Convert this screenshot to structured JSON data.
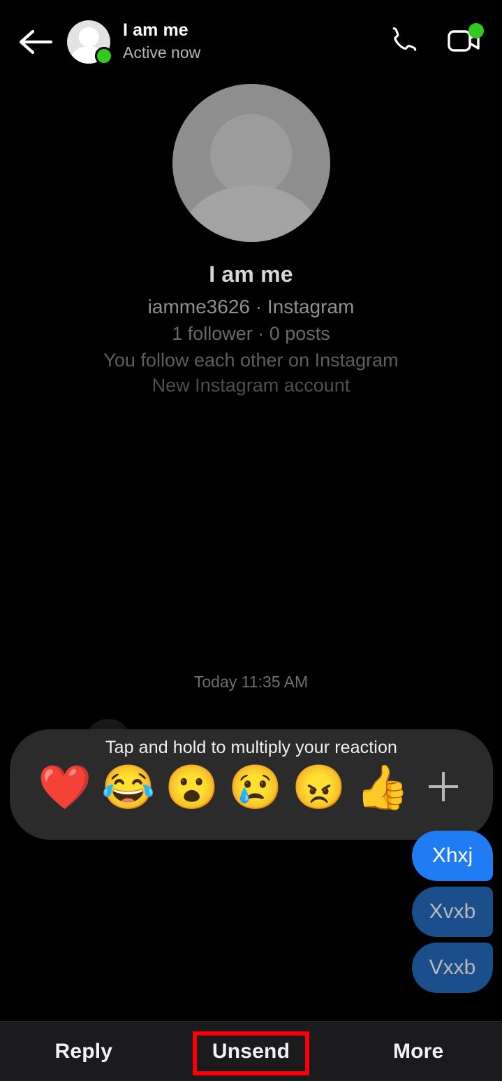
{
  "app": "Instagram Direct Message",
  "header": {
    "back_icon": "arrow-left-icon",
    "avatar_icon": "default-person-avatar",
    "online_badge": "online-dot",
    "name": "I am me",
    "status": "Active now",
    "call_icon": "phone-icon",
    "video_icon": "video-camera-icon",
    "video_badge": "online-dot"
  },
  "profile": {
    "avatar_icon": "default-person-avatar-large",
    "name": "I am me",
    "handle": "iamme3626 · Instagram",
    "stats": "1 follower · 0 posts",
    "relationship": "You follow each other on Instagram",
    "note": "New Instagram account"
  },
  "conversation": {
    "timestamp": "Today 11:35 AM",
    "messages": [
      {
        "text": "Xhxj",
        "side": "outgoing",
        "selected": true
      },
      {
        "text": "Xvxb",
        "side": "outgoing",
        "selected": false
      },
      {
        "text": "Vxxb",
        "side": "outgoing",
        "selected": false
      }
    ]
  },
  "reaction_bar": {
    "hint": "Tap and hold to multiply your reaction",
    "reactions": [
      {
        "name": "heart-reaction",
        "glyph": "❤️"
      },
      {
        "name": "laughing-reaction",
        "glyph": "😂"
      },
      {
        "name": "wow-reaction",
        "glyph": "😮"
      },
      {
        "name": "sad-reaction",
        "glyph": "😢"
      },
      {
        "name": "angry-reaction",
        "glyph": "😠"
      },
      {
        "name": "like-reaction",
        "glyph": "👍"
      }
    ],
    "add_more_icon": "plus-icon"
  },
  "action_bar": {
    "items": [
      {
        "label": "Reply",
        "highlighted": false
      },
      {
        "label": "Unsend",
        "highlighted": true
      },
      {
        "label": "More",
        "highlighted": false
      }
    ]
  },
  "colors": {
    "background": "#000000",
    "bubble_outgoing": "#1f7cf2",
    "bubble_dimmed": "#1a4f8c",
    "sheet": "#2b2b2b",
    "action_bar": "#1b1b1d",
    "highlight_box": "#fb0007",
    "online_green": "#31cb1f"
  }
}
